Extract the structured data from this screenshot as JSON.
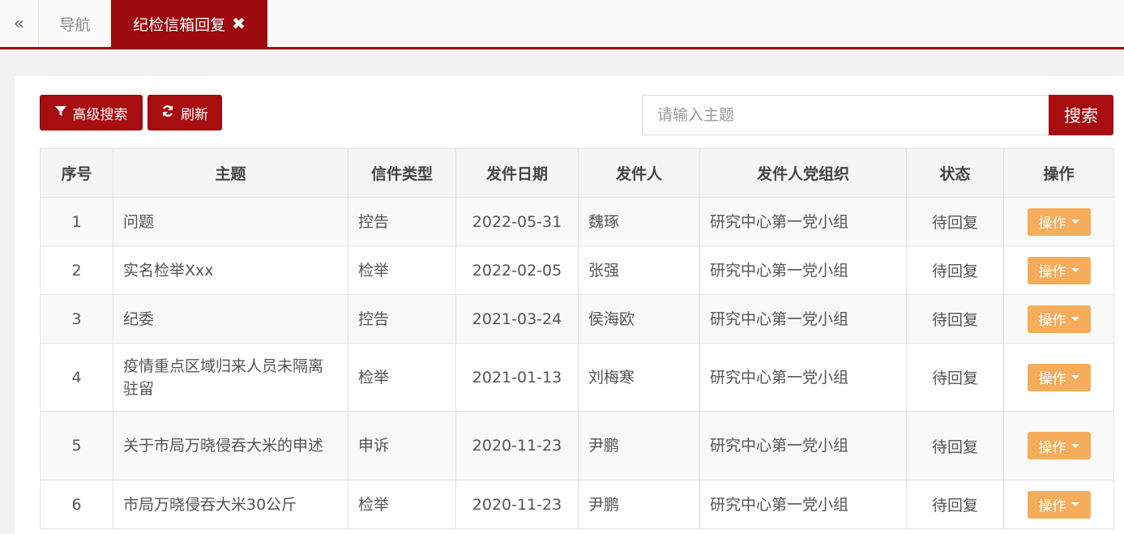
{
  "tabs": {
    "collapse_icon": "«",
    "home_label": "导航",
    "active_label": "纪检信箱回复",
    "close_icon": "✖"
  },
  "toolbar": {
    "advanced_search_label": "高级搜索",
    "refresh_label": "刷新",
    "search_placeholder": "请输入主题",
    "search_button_label": "搜索",
    "colors": {
      "primary": "#a80d10",
      "action": "#f5ac5b"
    }
  },
  "table": {
    "headers": [
      "序号",
      "主题",
      "信件类型",
      "发件日期",
      "发件人",
      "发件人党组织",
      "状态",
      "操作"
    ],
    "rows": [
      {
        "no": "1",
        "subject": "问题",
        "type": "控告",
        "date": "2022-05-31",
        "sender": "魏琢",
        "org": "研究中心第一党小组",
        "status": "待回复",
        "action": "操作"
      },
      {
        "no": "2",
        "subject": "实名检举Xxx",
        "type": "检举",
        "date": "2022-02-05",
        "sender": "张强",
        "org": "研究中心第一党小组",
        "status": "待回复",
        "action": "操作"
      },
      {
        "no": "3",
        "subject": "纪委",
        "type": "控告",
        "date": "2021-03-24",
        "sender": "侯海欧",
        "org": "研究中心第一党小组",
        "status": "待回复",
        "action": "操作"
      },
      {
        "no": "4",
        "subject": "疫情重点区域归来人员未隔离驻留",
        "type": "检举",
        "date": "2021-01-13",
        "sender": "刘梅寒",
        "org": "研究中心第一党小组",
        "status": "待回复",
        "action": "操作"
      },
      {
        "no": "5",
        "subject": "关于市局万晓侵吞大米的申述",
        "type": "申诉",
        "date": "2020-11-23",
        "sender": "尹鹏",
        "org": "研究中心第一党小组",
        "status": "待回复",
        "action": "操作"
      },
      {
        "no": "6",
        "subject": "市局万晓侵吞大米30公斤",
        "type": "检举",
        "date": "2020-11-23",
        "sender": "尹鹏",
        "org": "研究中心第一党小组",
        "status": "待回复",
        "action": "操作"
      }
    ]
  }
}
